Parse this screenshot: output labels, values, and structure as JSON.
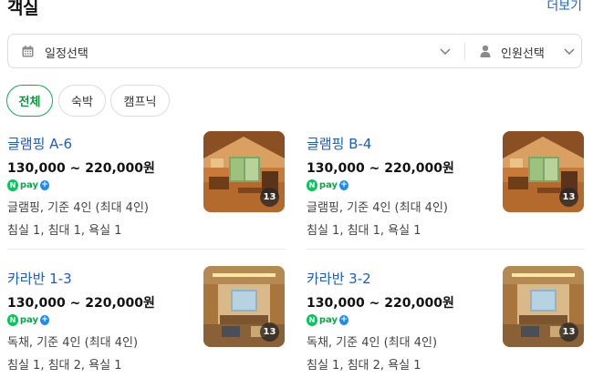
{
  "header": {
    "title": "객실",
    "more_label": "더보기"
  },
  "selector": {
    "date_label": "일정선택",
    "person_label": "인원선택"
  },
  "filters": [
    {
      "label": "전체",
      "active": true
    },
    {
      "label": "숙박",
      "active": false
    },
    {
      "label": "캠프닉",
      "active": false
    }
  ],
  "rooms": [
    {
      "name": "글램핑 A-6",
      "price": "130,000 ~ 220,000원",
      "npay": "pay",
      "detail": "글램핑, 기준 4인 (최대 4인)",
      "rooms": "침실 1, 침대 1, 욕실 1",
      "photo_count": "13",
      "photo": "wood-interior"
    },
    {
      "name": "글램핑 B-4",
      "price": "130,000 ~ 220,000원",
      "npay": "pay",
      "detail": "글램핑, 기준 4인 (최대 4인)",
      "rooms": "침실 1, 침대 1, 욕실 1",
      "photo_count": "13",
      "photo": "wood-interior"
    },
    {
      "name": "카라반 1-3",
      "price": "130,000 ~ 220,000원",
      "npay": "pay",
      "detail": "독채, 기준 4인 (최대 4인)",
      "rooms": "침실 1, 침대 2, 욕실 1",
      "photo_count": "13",
      "photo": "caravan-interior"
    },
    {
      "name": "카라반 3-2",
      "price": "130,000 ~ 220,000원",
      "npay": "pay",
      "detail": "독채, 기준 4인 (최대 4인)",
      "rooms": "침실 1, 침대 2, 욕실 1",
      "photo_count": "13",
      "photo": "caravan-interior"
    }
  ],
  "colors": {
    "link": "#1e66c8",
    "room_name": "#1e5dbd",
    "active_chip": "#1aa84b",
    "npay_green": "#03c75a",
    "npay_plus": "#1d8cf0"
  }
}
